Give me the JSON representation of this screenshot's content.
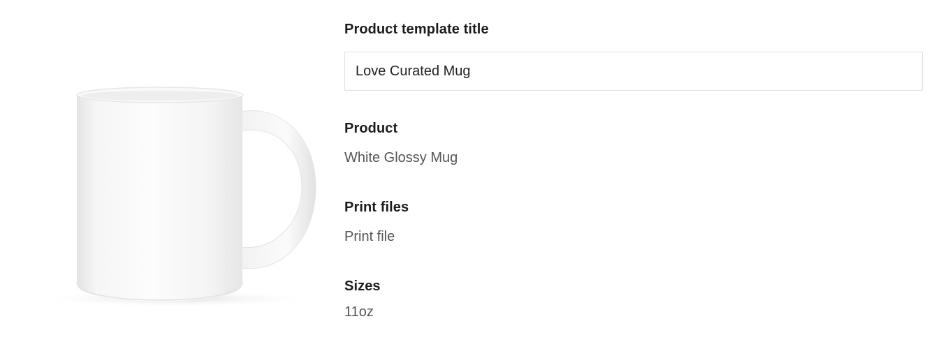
{
  "preview": {
    "image_icon": "white-mug-product-image"
  },
  "fields": {
    "template_title": {
      "label": "Product template title",
      "value": "Love Curated Mug"
    },
    "product": {
      "label": "Product",
      "value": "White Glossy Mug"
    },
    "print_files": {
      "label": "Print files",
      "value": "Print file"
    },
    "sizes": {
      "label": "Sizes",
      "value": "11oz"
    }
  }
}
